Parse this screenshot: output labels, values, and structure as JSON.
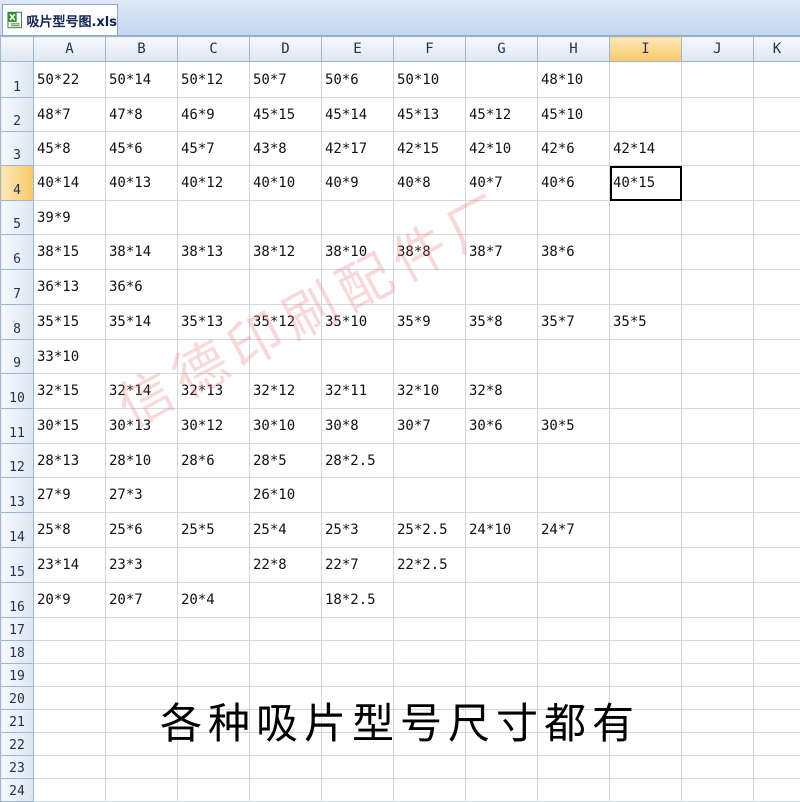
{
  "tab": {
    "filename": "吸片型号图.xls"
  },
  "columns": [
    "A",
    "B",
    "C",
    "D",
    "E",
    "F",
    "G",
    "H",
    "I",
    "J",
    "K"
  ],
  "selected_column": "I",
  "selected_row": "4",
  "rows": [
    {
      "num": "1",
      "cells": [
        "50*22",
        "50*14",
        "50*12",
        "50*7",
        "50*6",
        "50*10",
        "",
        "48*10",
        "",
        "",
        ""
      ]
    },
    {
      "num": "2",
      "cells": [
        "48*7",
        "47*8",
        "46*9",
        "45*15",
        "45*14",
        "45*13",
        "45*12",
        "45*10",
        "",
        "",
        ""
      ]
    },
    {
      "num": "3",
      "cells": [
        "45*8",
        "45*6",
        "45*7",
        "43*8",
        "42*17",
        "42*15",
        "42*10",
        "42*6",
        "42*14",
        "",
        ""
      ]
    },
    {
      "num": "4",
      "cells": [
        "40*14",
        "40*13",
        "40*12",
        "40*10",
        "40*9",
        "40*8",
        "40*7",
        "40*6",
        "40*15",
        "",
        ""
      ]
    },
    {
      "num": "5",
      "cells": [
        "39*9",
        "",
        "",
        "",
        "",
        "",
        "",
        "",
        "",
        "",
        ""
      ]
    },
    {
      "num": "6",
      "cells": [
        "38*15",
        "38*14",
        "38*13",
        "38*12",
        "38*10",
        "38*8",
        "38*7",
        "38*6",
        "",
        "",
        ""
      ]
    },
    {
      "num": "7",
      "cells": [
        "36*13",
        "36*6",
        "",
        "",
        "",
        "",
        "",
        "",
        "",
        "",
        ""
      ]
    },
    {
      "num": "8",
      "cells": [
        "35*15",
        "35*14",
        "35*13",
        "35*12",
        "35*10",
        "35*9",
        "35*8",
        "35*7",
        "35*5",
        "",
        ""
      ]
    },
    {
      "num": "9",
      "cells": [
        "33*10",
        "",
        "",
        "",
        "",
        "",
        "",
        "",
        "",
        "",
        ""
      ]
    },
    {
      "num": "10",
      "cells": [
        "32*15",
        "32*14",
        "32*13",
        "32*12",
        "32*11",
        "32*10",
        "32*8",
        "",
        "",
        "",
        ""
      ]
    },
    {
      "num": "11",
      "cells": [
        "30*15",
        "30*13",
        "30*12",
        "30*10",
        "30*8",
        "30*7",
        "30*6",
        "30*5",
        "",
        "",
        ""
      ]
    },
    {
      "num": "12",
      "cells": [
        "28*13",
        "28*10",
        "28*6",
        "28*5",
        "28*2.5",
        "",
        "",
        "",
        "",
        "",
        ""
      ]
    },
    {
      "num": "13",
      "cells": [
        "27*9",
        "27*3",
        "",
        "26*10",
        "",
        "",
        "",
        "",
        "",
        "",
        ""
      ]
    },
    {
      "num": "14",
      "cells": [
        "25*8",
        "25*6",
        "25*5",
        "25*4",
        "25*3",
        "25*2.5",
        "24*10",
        "24*7",
        "",
        "",
        ""
      ]
    },
    {
      "num": "15",
      "cells": [
        "23*14",
        "23*3",
        "",
        "22*8",
        "22*7",
        "22*2.5",
        "",
        "",
        "",
        "",
        ""
      ]
    },
    {
      "num": "16",
      "cells": [
        "20*9",
        "20*7",
        "20*4",
        "",
        "18*2.5",
        "",
        "",
        "",
        "",
        "",
        ""
      ]
    },
    {
      "num": "17",
      "cells": [
        "",
        "",
        "",
        "",
        "",
        "",
        "",
        "",
        "",
        "",
        ""
      ]
    },
    {
      "num": "18",
      "cells": [
        "",
        "",
        "",
        "",
        "",
        "",
        "",
        "",
        "",
        "",
        ""
      ]
    },
    {
      "num": "19",
      "cells": [
        "",
        "",
        "",
        "",
        "",
        "",
        "",
        "",
        "",
        "",
        ""
      ]
    },
    {
      "num": "20",
      "cells": [
        "",
        "",
        "",
        "",
        "",
        "",
        "",
        "",
        "",
        "",
        ""
      ]
    },
    {
      "num": "21",
      "cells": [
        "",
        "",
        "",
        "",
        "",
        "",
        "",
        "",
        "",
        "",
        ""
      ]
    },
    {
      "num": "22",
      "cells": [
        "",
        "",
        "",
        "",
        "",
        "",
        "",
        "",
        "",
        "",
        ""
      ]
    },
    {
      "num": "23",
      "cells": [
        "",
        "",
        "",
        "",
        "",
        "",
        "",
        "",
        "",
        "",
        ""
      ]
    },
    {
      "num": "24",
      "cells": [
        "",
        "",
        "",
        "",
        "",
        "",
        "",
        "",
        "",
        "",
        ""
      ]
    }
  ],
  "watermark": "信德印刷配件厂",
  "caption": "各种吸片型号尺寸都有",
  "colors": {
    "selection_header": "#f8c966",
    "grid_line": "#d0d7e5",
    "watermark": "#e67878"
  }
}
